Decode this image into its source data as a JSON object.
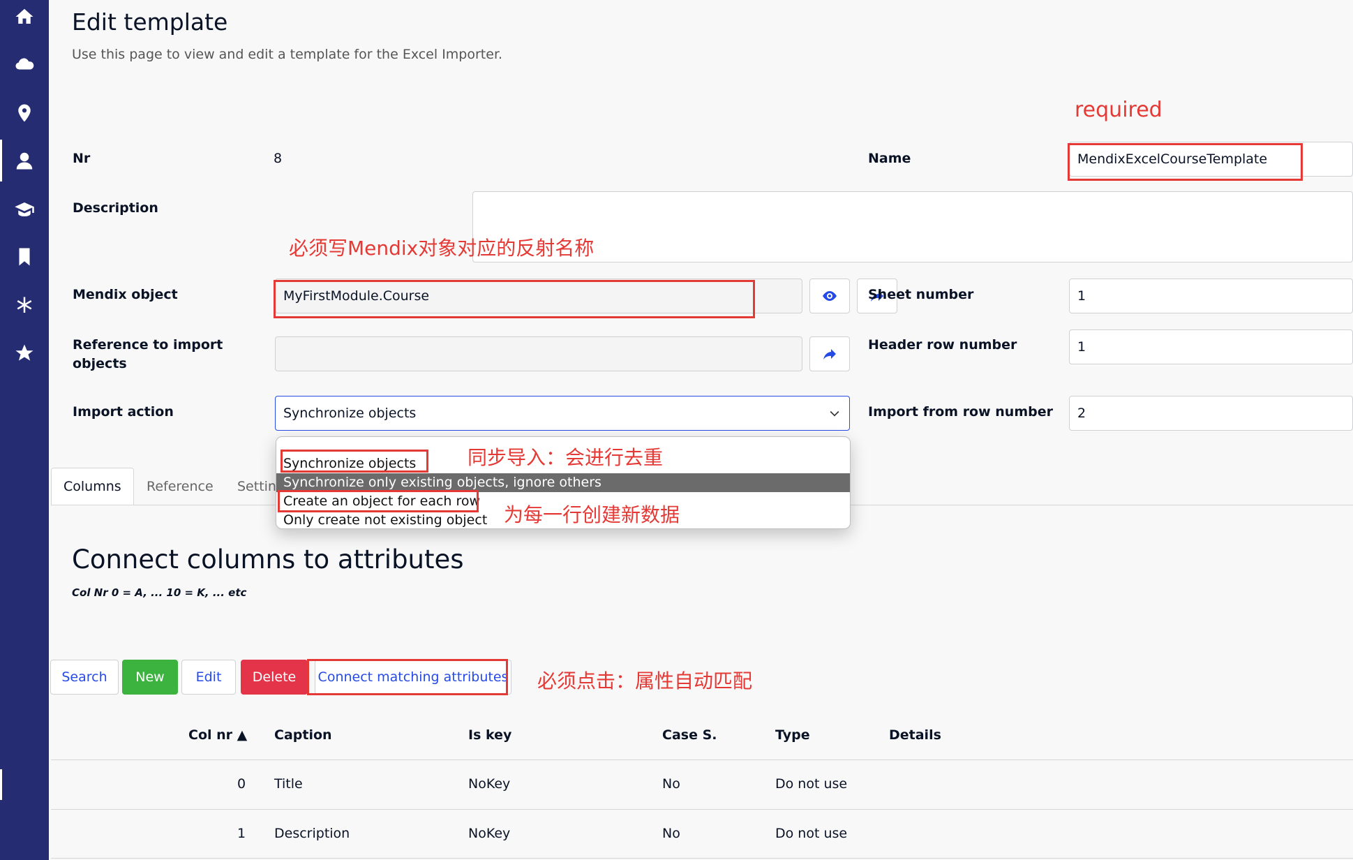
{
  "page": {
    "title": "Edit template",
    "subtitle": "Use this page to view and edit a template for the Excel Importer."
  },
  "sidebar": {
    "icons": [
      "home-icon",
      "cloud-icon",
      "location-pin-icon",
      "user-icon",
      "graduation-cap-icon",
      "bookmark-icon",
      "asterisk-icon",
      "star-icon"
    ]
  },
  "form": {
    "nr_label": "Nr",
    "nr_value": "8",
    "name_label": "Name",
    "name_value": "MendixExcelCourseTemplate",
    "description_label": "Description",
    "description_value": "",
    "mendix_object_label": "Mendix object",
    "mendix_object_value": "MyFirstModule.Course",
    "reference_label": "Reference to import objects",
    "reference_value": "",
    "import_action_label": "Import action",
    "import_action_value": "Synchronize objects",
    "sheet_number_label": "Sheet number",
    "sheet_number_value": "1",
    "header_row_label": "Header row number",
    "header_row_value": "1",
    "import_from_row_label": "Import from row number",
    "import_from_row_value": "2"
  },
  "dropdown": {
    "options": [
      "Synchronize objects",
      "Synchronize only existing objects, ignore others",
      "Create an object for each row",
      "Only create not existing object"
    ],
    "highlighted_index": 1
  },
  "annotations": {
    "required": "required",
    "reflection_name": "必须写Mendix对象对应的反射名称",
    "sync_import": "同步导入：会进行去重",
    "new_each_row": "为每一行创建新数据",
    "must_click": "必须点击：属性自动匹配",
    "color": "#e53935"
  },
  "tabs": [
    "Columns",
    "Reference",
    "Setting"
  ],
  "section": {
    "title": "Connect columns to attributes",
    "note": "Col Nr 0 = A, ... 10 = K, ... etc"
  },
  "toolbar": {
    "search": "Search",
    "new": "New",
    "edit": "Edit",
    "delete": "Delete",
    "connect": "Connect matching attributes"
  },
  "table": {
    "headers": [
      "Col nr ▲",
      "Caption",
      "Is key",
      "Case S.",
      "Type",
      "Details"
    ],
    "rows": [
      {
        "col_nr": "0",
        "caption": "Title",
        "is_key": "NoKey",
        "case_s": "No",
        "type": "Do not use",
        "details": ""
      },
      {
        "col_nr": "1",
        "caption": "Description",
        "is_key": "NoKey",
        "case_s": "No",
        "type": "Do not use",
        "details": ""
      }
    ]
  },
  "colors": {
    "sidebar": "#262c72",
    "accent": "#264ae5",
    "new_button": "#3cb33e",
    "delete_button": "#e3344a"
  }
}
